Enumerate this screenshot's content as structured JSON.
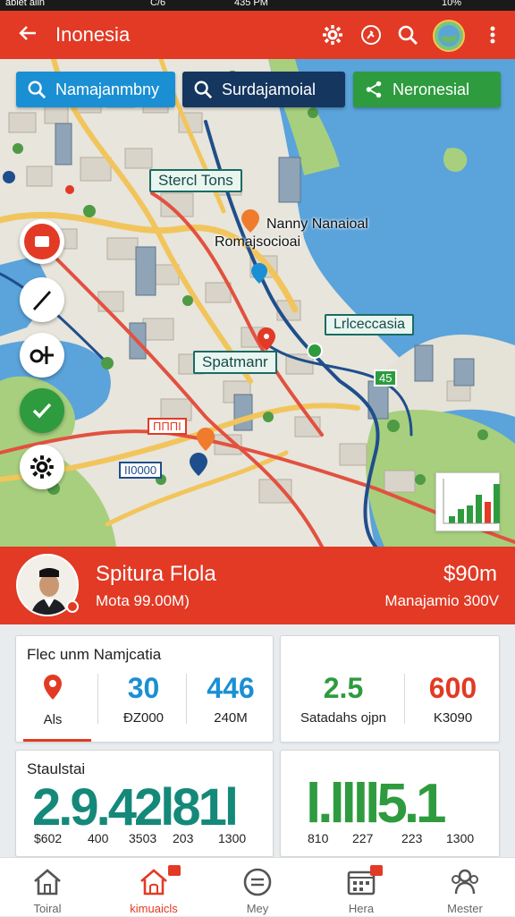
{
  "status_bar": {
    "left": "ablet alin",
    "carrier": "C/6",
    "time": "435 PM",
    "battery": "10%"
  },
  "app_bar": {
    "title": "Inonesia",
    "back_icon": "arrow-left-icon",
    "icons": [
      "gear-icon",
      "run-icon",
      "search-icon",
      "avatar",
      "more-vert-icon"
    ]
  },
  "chips": [
    {
      "label": "Namajanmbny",
      "color": "#1b8fd3",
      "icon": "search-icon"
    },
    {
      "label": "Surdajamoial",
      "color": "#14365f",
      "icon": "search-icon"
    },
    {
      "label": "Neronesial",
      "color": "#2e9b3e",
      "icon": "share-icon"
    }
  ],
  "map": {
    "labels": {
      "street_tons": "Stercl Tons",
      "nanny": "Nanny Nanaioal",
      "romajsocioai": "Romajsocioai",
      "ulceccasia": "Lrlceccasia",
      "spatmanr": "Spatmanr",
      "red_badge": "ΠΠΠΙ",
      "blue_badge": "ΙΙ0000",
      "green_badge": "45"
    }
  },
  "fabs": [
    "map-pin-red-icon",
    "pen-icon",
    "sliders-icon",
    "check-icon",
    "gear-icon"
  ],
  "mini_chart": {
    "values": [
      1,
      2,
      2.5,
      4,
      3,
      5.5
    ],
    "colors": [
      "#2e9b3e",
      "#2e9b3e",
      "#2e9b3e",
      "#2e9b3e",
      "#e23a25",
      "#2e9b3e"
    ]
  },
  "profile": {
    "name": "Spitura Flola",
    "subtitle": "Mota 99.00M)",
    "amount": "$90m",
    "amount_sub": "Manajamio 300V"
  },
  "card1": {
    "title": "Flec unm Namjcatia",
    "metrics": [
      {
        "value": "",
        "label": "Als",
        "icon": "location-pin-icon"
      },
      {
        "value": "30",
        "label": "ĐZ000",
        "color": "#1b8fd3"
      },
      {
        "value": "446",
        "label": "240M",
        "color": "#1b8fd3"
      }
    ]
  },
  "card2": {
    "metrics": [
      {
        "value": "2.5",
        "label": "Satadahs ojpn",
        "color": "#2e9b3e"
      },
      {
        "value": "600",
        "label": "K3090",
        "color": "#e23a25"
      }
    ]
  },
  "card3": {
    "title": "Staulstai",
    "big_text": "2.9.42l81l",
    "labels": [
      "$602",
      "400",
      "3503",
      "203",
      "1300"
    ]
  },
  "card4": {
    "big_text": "l.llll5.1",
    "labels": [
      "810",
      "227",
      "223",
      "1300"
    ]
  },
  "bottom_nav": [
    {
      "label": "Toiral",
      "icon": "home-icon",
      "active": false
    },
    {
      "label": "kimuaicls",
      "icon": "home-badge-icon",
      "active": true
    },
    {
      "label": "Mey",
      "icon": "menu-circle-icon",
      "active": false
    },
    {
      "label": "Hera",
      "icon": "calendar-icon",
      "active": false
    },
    {
      "label": "Mester",
      "icon": "people-icon",
      "active": false
    }
  ]
}
